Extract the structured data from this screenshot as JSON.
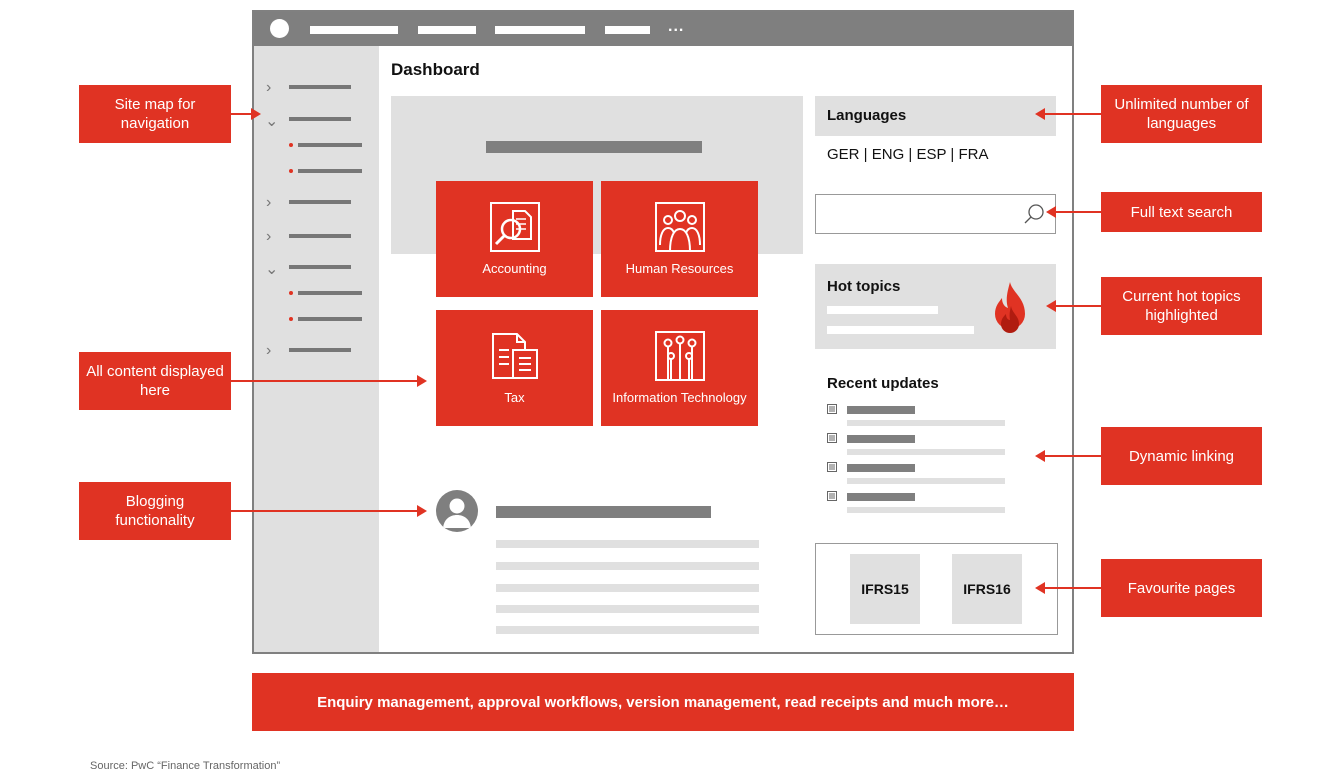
{
  "window": {
    "dashboard_title": "Dashboard",
    "tiles": [
      {
        "label": "Accounting",
        "icon": "accounting-icon"
      },
      {
        "label": "Human Resources",
        "icon": "human-resources-icon"
      },
      {
        "label": "Tax",
        "icon": "tax-document-icon"
      },
      {
        "label": "Information Technology",
        "icon": "circuit-icon"
      }
    ],
    "languages": {
      "heading": "Languages",
      "list": "GER | ENG | ESP | FRA"
    },
    "hot_topics": {
      "heading": "Hot topics",
      "icon": "flame-icon"
    },
    "recent_updates": {
      "heading": "Recent updates",
      "icon": "document-icon"
    },
    "favourites": [
      "IFRS15",
      "IFRS16"
    ]
  },
  "callouts": {
    "site_map": "Site map for navigation",
    "all_content": "All content displayed here",
    "blogging": "Blogging functionality",
    "languages": "Unlimited number of languages",
    "search": "Full text search",
    "hot_topics": "Current hot topics highlighted",
    "dynamic_linking": "Dynamic linking",
    "favourite_pages": "Favourite pages"
  },
  "footer": "Enquiry management, approval workflows, version management, read receipts and much more…",
  "source": "Source: PwC “Finance Transformation”",
  "colors": {
    "accent": "#e03323",
    "mid_gray": "#7f7f7f",
    "light_gray": "#e0e0e0"
  }
}
